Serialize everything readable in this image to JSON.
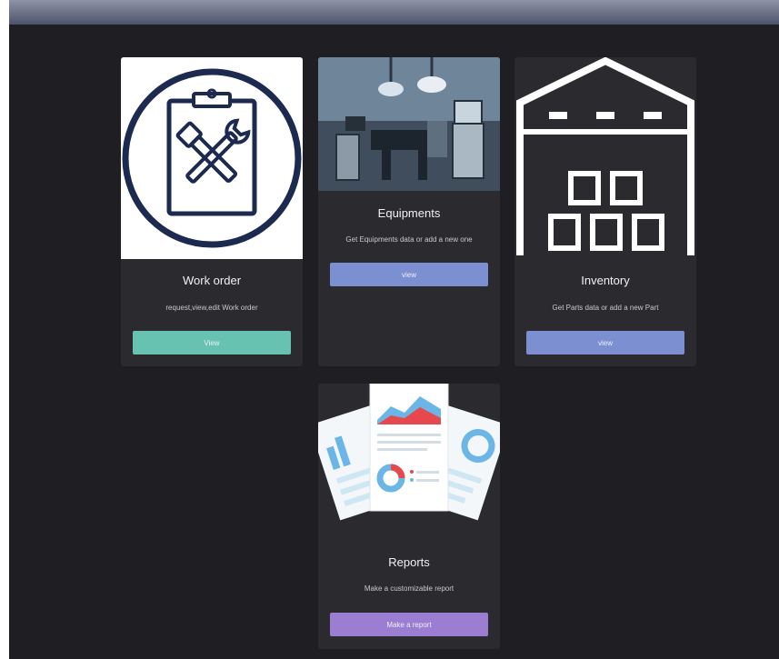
{
  "cards": [
    {
      "title": "Work order",
      "description": "request,view,edit Work order",
      "button_label": "View",
      "button_color": "#67c2b2"
    },
    {
      "title": "Equipments",
      "description": "Get Equipments data or add a new one",
      "button_label": "view",
      "button_color": "#7b8fd1"
    },
    {
      "title": "Inventory",
      "description": "Get Parts data or add a new Part",
      "button_label": "view",
      "button_color": "#7b8fd1"
    },
    {
      "title": "Reports",
      "description": "Make a customizable report",
      "button_label": "Make a report",
      "button_color": "#9b7dd1"
    }
  ],
  "colors": {
    "background": "#1f1f23",
    "card": "#2a2a2f",
    "topbar": "#6a7088",
    "work_order_icon": "#1b2a4e"
  },
  "icons": [
    "clipboard-wrench-icon",
    "operating-room-photo",
    "warehouse-icon",
    "reports-documents-icon"
  ]
}
